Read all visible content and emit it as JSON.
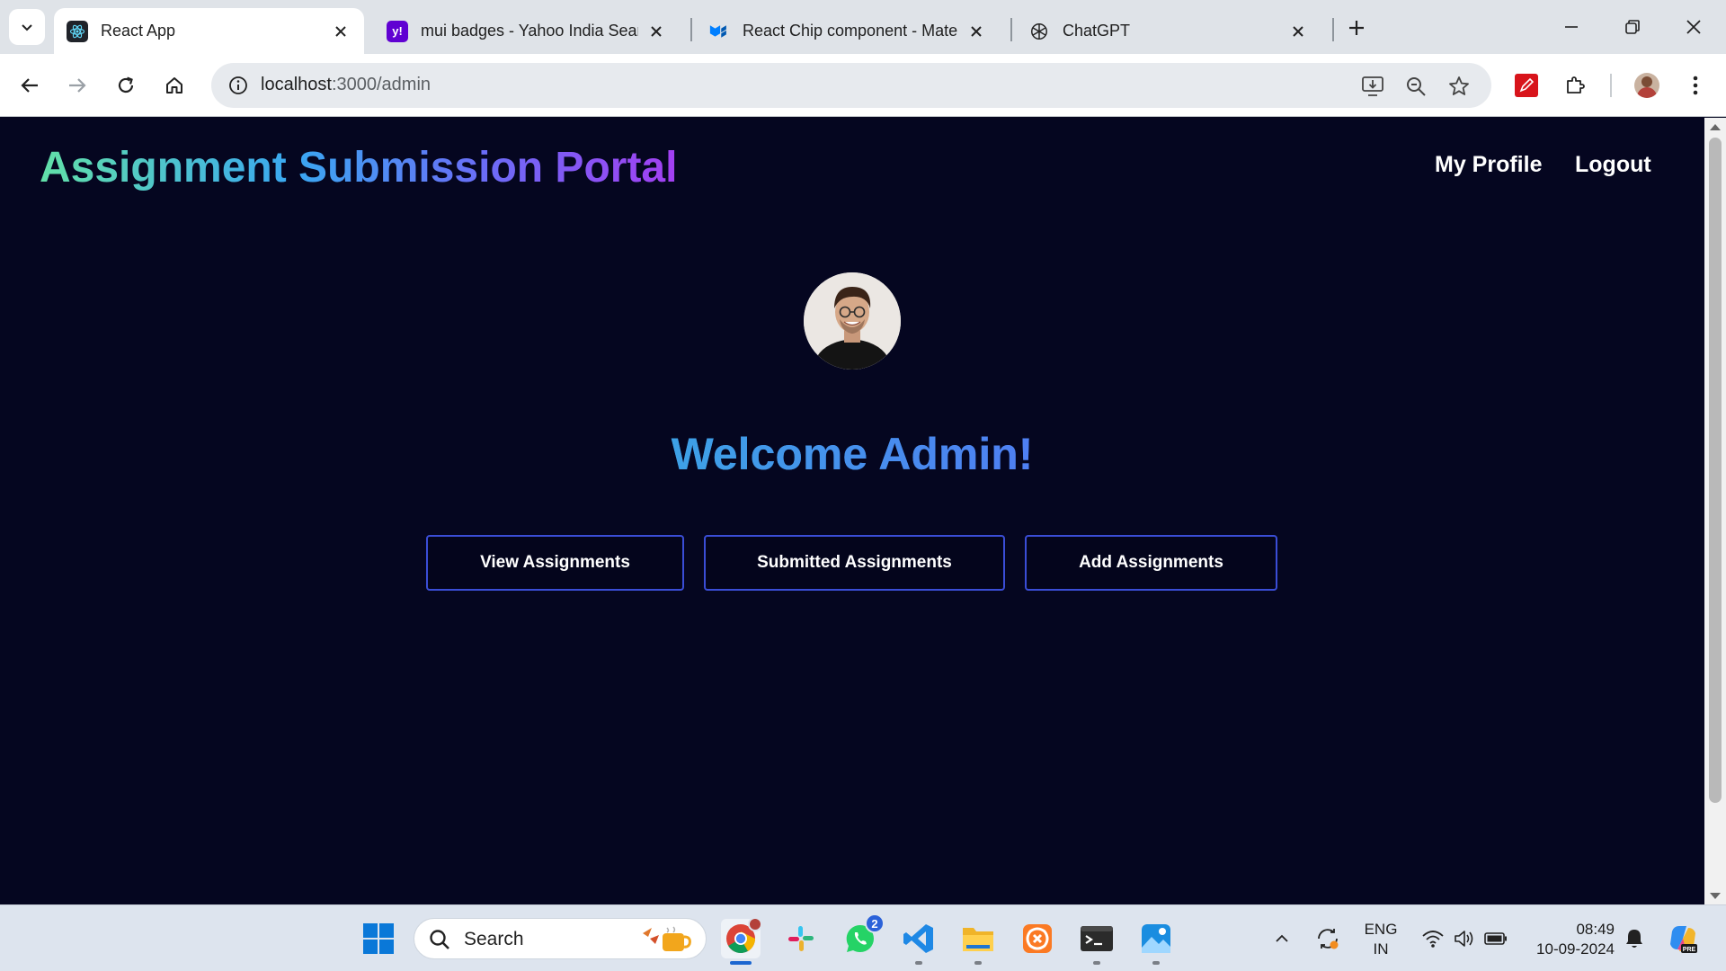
{
  "browser": {
    "tabs": [
      {
        "title": "React App",
        "active": true,
        "favicon": "react-icon"
      },
      {
        "title": "mui badges - Yahoo India Search",
        "active": false,
        "favicon": "yahoo-icon"
      },
      {
        "title": "React Chip component - Material UI",
        "active": false,
        "favicon": "mui-icon"
      },
      {
        "title": "ChatGPT",
        "active": false,
        "favicon": "chatgpt-icon"
      }
    ],
    "url_host": "localhost",
    "url_path": ":3000/admin"
  },
  "page": {
    "brand": "Assignment Submission Portal",
    "nav": {
      "profile": "My Profile",
      "logout": "Logout"
    },
    "welcome": "Welcome Admin!",
    "buttons": {
      "view": "View Assignments",
      "submitted": "Submitted Assignments",
      "add": "Add Assignments"
    }
  },
  "taskbar": {
    "search_label": "Search",
    "whatsapp_badge": "2",
    "lang_top": "ENG",
    "lang_bottom": "IN",
    "time": "08:49",
    "date": "10-09-2024"
  },
  "colors": {
    "page_bg": "#050620",
    "button_border": "#3a4dd6",
    "brand_start": "#62e0a8",
    "brand_end": "#a33ff2"
  }
}
